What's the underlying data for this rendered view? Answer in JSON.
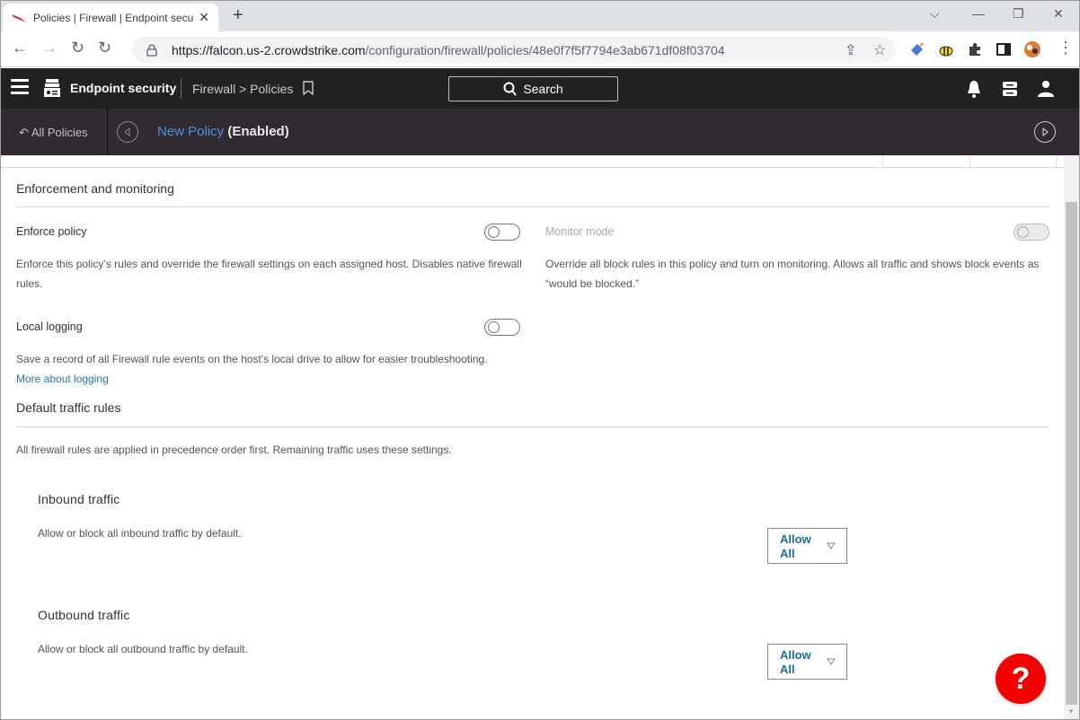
{
  "browser": {
    "tab_title": "Policies | Firewall | Endpoint secu",
    "tab_close": "✕",
    "new_tab": "+",
    "url_host": "https://falcon.us-2.crowdstrike.com",
    "url_path": "/configuration/firewall/policies/48e0f7f5f7794e3ab671df08f03704",
    "window_controls": [
      "⌵",
      "—",
      "❐",
      "✕"
    ]
  },
  "app_header": {
    "app_name": "Endpoint security",
    "breadcrumb": "Firewall > Policies",
    "search_label": "Search"
  },
  "subheader": {
    "back_label": "All Policies",
    "policy_name": "New Policy",
    "policy_status": "(Enabled)"
  },
  "enforcement": {
    "title": "Enforcement and monitoring",
    "enforce_policy": {
      "label": "Enforce policy",
      "enabled": false,
      "description": "Enforce this policy’s rules and override the firewall settings on each assigned host. Disables native firewall rules."
    },
    "monitor_mode": {
      "label": "Monitor mode",
      "enabled": false,
      "disabled": true,
      "description": "Override all block rules in this policy and turn on monitoring. Allows all traffic and shows block events as “would be blocked.”"
    },
    "local_logging": {
      "label": "Local logging",
      "enabled": false,
      "description": "Save a record of all Firewall rule events on the host's local drive to allow for easier troubleshooting.",
      "link_text": "More about logging"
    }
  },
  "default_traffic": {
    "title": "Default traffic rules",
    "description": "All firewall rules are applied in precedence order first. Remaining traffic uses these settings.",
    "inbound": {
      "title": "Inbound traffic",
      "description": "Allow or block all inbound traffic by default.",
      "selected": "Allow All"
    },
    "outbound": {
      "title": "Outbound traffic",
      "description": "Allow or block all outbound traffic by default.",
      "selected": "Allow All"
    }
  },
  "help_button": "?"
}
